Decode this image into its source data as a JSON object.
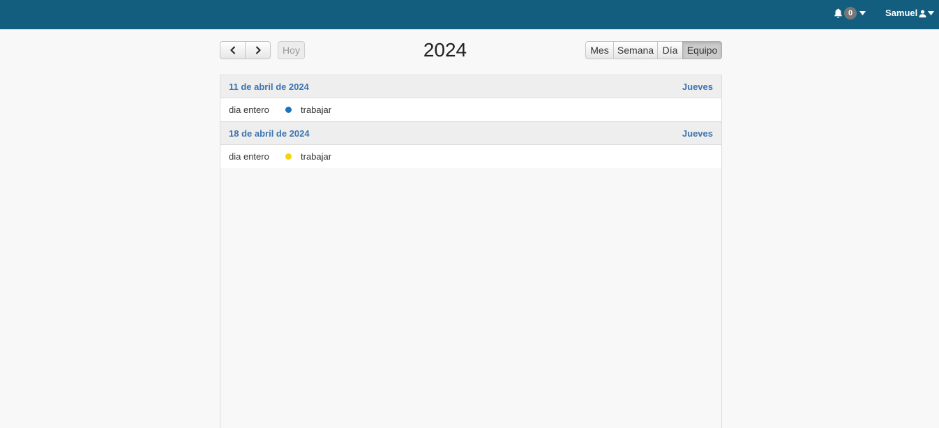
{
  "topbar": {
    "notifications_count": "0",
    "user_name": "Samuel",
    "bg_color": "#135e7f"
  },
  "toolbar": {
    "prev_icon": "chevron-left-icon",
    "next_icon": "chevron-right-icon",
    "today_label": "Hoy",
    "title": "2024",
    "views": [
      {
        "label": "Mes",
        "active": false
      },
      {
        "label": "Semana",
        "active": false
      },
      {
        "label": "Día",
        "active": false
      },
      {
        "label": "Equipo",
        "active": true
      }
    ]
  },
  "days": [
    {
      "date": "11 de abril de 2024",
      "weekday": "Jueves",
      "events": [
        {
          "time": "dia entero",
          "title": "trabajar",
          "color": "#1a73c0"
        }
      ]
    },
    {
      "date": "18 de abril de 2024",
      "weekday": "Jueves",
      "events": [
        {
          "time": "dia entero",
          "title": "trabajar",
          "color": "#f3d20f"
        }
      ]
    }
  ]
}
